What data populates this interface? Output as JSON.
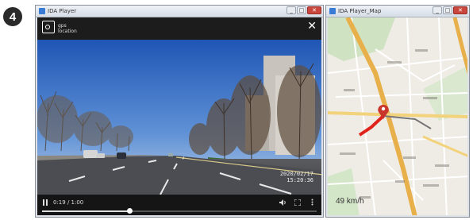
{
  "step_number": "4",
  "player": {
    "window_title": "IDA Player",
    "gps_label_line1": "gps",
    "gps_label_line2": "location",
    "close_glyph": "✕",
    "timestamp_date": "2020/02/17",
    "timestamp_time": "15:20:36",
    "time_display": "0:19 / 1:00",
    "progress_fraction": 0.317,
    "icons": [
      "pause-icon",
      "volume-icon",
      "fullscreen-icon",
      "more-icon"
    ]
  },
  "map": {
    "window_title": "IDA Player_Map",
    "speed": "49 km/h",
    "route_color": "#e0241b",
    "road_color": "#e8b04a"
  },
  "window_buttons": {
    "min": "_",
    "max": "□",
    "close": "✕"
  }
}
